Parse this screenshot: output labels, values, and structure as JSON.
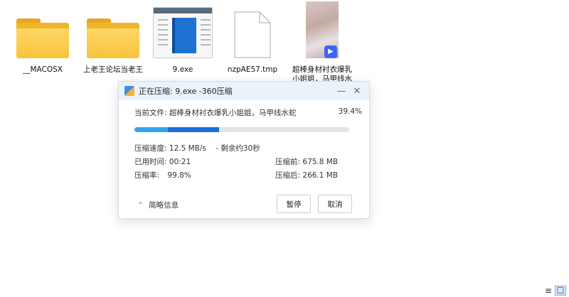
{
  "desktop": {
    "items": [
      {
        "label": "__MACOSX",
        "type": "folder"
      },
      {
        "label": "上老王论坛当老王",
        "type": "folder"
      },
      {
        "label": "9.exe",
        "type": "exe"
      },
      {
        "label": "nzpAE57.tmp",
        "type": "file"
      },
      {
        "label": "超棒身材衬衣爆乳小姐姐，马甲线水蛇",
        "type": "video"
      }
    ]
  },
  "dialog": {
    "title": "正在压缩: 9.exe -360压缩",
    "minimize_symbol": "—",
    "close_symbol": "✕",
    "current_file_label": "当前文件:",
    "current_file_name": "超棒身材衬衣爆乳小姐姐，马甲线水蛇",
    "percent_text": "39.4%",
    "progress": {
      "overall_fraction": 0.394,
      "current_start_fraction": 0.155
    },
    "speed_label": "压缩速度:",
    "speed_value": "12.5 MB/s",
    "remaining_text": "- 剩余约30秒",
    "elapsed_label": "已用时间:",
    "elapsed_value": "00:21",
    "before_label": "压缩前:",
    "before_value": "675.8 MB",
    "ratio_label": "压缩率:",
    "ratio_value": "99.8%",
    "after_label": "压缩后:",
    "after_value": "266.1 MB",
    "details_toggle_symbol": "⌃",
    "details_label": "简略信息",
    "pause_label": "暂停",
    "cancel_label": "取消"
  },
  "view_controls": {
    "details_symbol": "≡",
    "icons_symbol": "☐"
  },
  "colors": {
    "progress_done": "#33a3ee",
    "progress_current": "#1a6fd6",
    "title_bar": "#eaf3fc"
  }
}
